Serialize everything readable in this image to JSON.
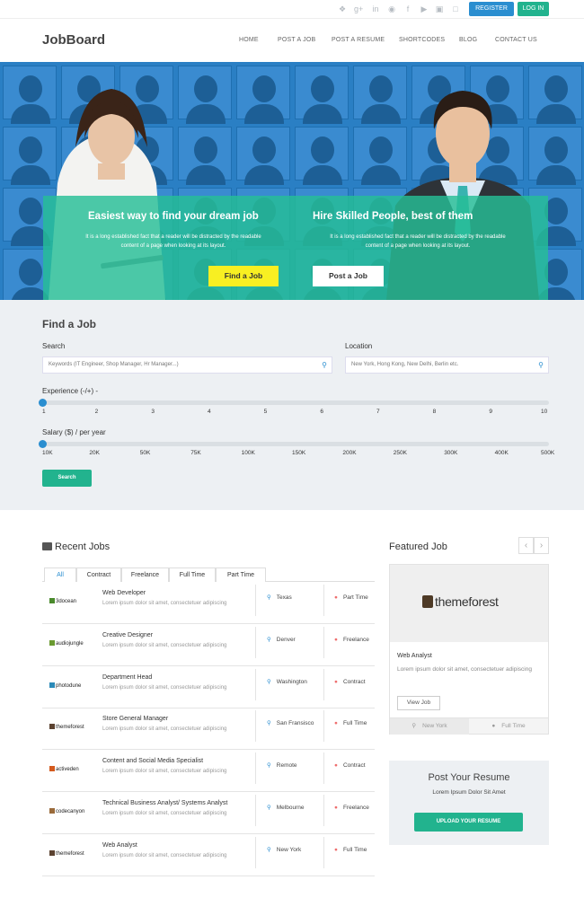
{
  "topbar": {
    "social_icons": [
      "twitter-icon",
      "google-plus-icon",
      "linkedin-icon",
      "pinterest-icon",
      "facebook-icon",
      "youtube-icon",
      "vimeo-icon",
      "vine-icon"
    ],
    "register_label": "REGISTER",
    "login_label": "LOG IN"
  },
  "header": {
    "logo": "JobBoard",
    "nav": [
      "HOME",
      "POST A JOB",
      "POST A RESUME",
      "SHORTCODES",
      "BLOG",
      "CONTACT US"
    ]
  },
  "hero": {
    "left": {
      "heading": "Easiest way to find your dream job",
      "text_line1": "It is a long established fact that a reader will be distracted by the readable",
      "text_line2": "content of a page when looking at its layout.",
      "button": "Find a Job"
    },
    "right": {
      "heading": "Hire Skilled People, best of them",
      "text_line1": "It is a long established fact that a reader will be distracted by the readable",
      "text_line2": "content of a page when looking at its layout.",
      "button": "Post a Job"
    }
  },
  "find": {
    "title": "Find a Job",
    "search_label": "Search",
    "search_placeholder": "Keywords (IT Engineer, Shop Manager, Hr Manager...)",
    "location_label": "Location",
    "location_placeholder": "New York, Hong Kong, New Delhi, Berlin etc.",
    "experience_label": "Experience (-/+) -",
    "experience_ticks": [
      "1",
      "2",
      "3",
      "4",
      "5",
      "6",
      "7",
      "8",
      "9",
      "10"
    ],
    "experience_value": 1,
    "salary_label": "Salary ($) / per year",
    "salary_ticks": [
      "10K",
      "20K",
      "50K",
      "75K",
      "100K",
      "150K",
      "200K",
      "250K",
      "300K",
      "400K",
      "500K"
    ],
    "salary_value": "10K",
    "search_button": "Search"
  },
  "recent": {
    "title": "Recent Jobs",
    "tabs": [
      "All",
      "Contract",
      "Freelance",
      "Full Time",
      "Part Time"
    ],
    "active_tab": "All",
    "jobs": [
      {
        "logo": "3docean",
        "logo_color": "#4a8a2c",
        "title": "Web Developer",
        "desc": "Lorem ipsum dolor sit amet, consectetuer adipiscing",
        "location": "Texas",
        "type": "Part Time"
      },
      {
        "logo": "audiojungle",
        "logo_color": "#6a9a30",
        "title": "Creative Designer",
        "desc": "Lorem ipsum dolor sit amet, consectetuer adipiscing",
        "location": "Denver",
        "type": "Freelance"
      },
      {
        "logo": "photodune",
        "logo_color": "#2c8ab8",
        "title": "Department Head",
        "desc": "Lorem ipsum dolor sit amet, consectetuer adipiscing",
        "location": "Washington",
        "type": "Contract"
      },
      {
        "logo": "themeforest",
        "logo_color": "#5b4230",
        "title": "Store General Manager",
        "desc": "Lorem ipsum dolor sit amet, consectetuer adipiscing",
        "location": "San Fransisco",
        "type": "Full Time"
      },
      {
        "logo": "activeden",
        "logo_color": "#d45a1e",
        "title": "Content and Social Media Specialist",
        "desc": "Lorem ipsum dolor sit amet, consectetuer adipiscing",
        "location": "Remote",
        "type": "Contract"
      },
      {
        "logo": "codecanyon",
        "logo_color": "#9a6a3a",
        "title": "Technical Business Analyst/ Systems Analyst",
        "desc": "Lorem ipsum dolor sit amet, consectetuer adipiscing",
        "location": "Melbourne",
        "type": "Freelance"
      },
      {
        "logo": "themeforest",
        "logo_color": "#5b4230",
        "title": "Web Analyst",
        "desc": "Lorem ipsum dolor sit amet, consectetuer adipiscing",
        "location": "New York",
        "type": "Full Time"
      }
    ]
  },
  "featured": {
    "title": "Featured Job",
    "logo_text": "themeforest",
    "job_title": "Web Analyst",
    "desc": "Lorem ipsum dolor sit amet, consectetuer adipiscing",
    "view_button": "View Job",
    "location": "New York",
    "type": "Full Time"
  },
  "resume": {
    "title": "Post Your Resume",
    "subtitle": "Lorem Ipsum Dolor Sit Amet",
    "button": "UPLOAD YOUR RESUME"
  },
  "colors": {
    "primary_blue": "#2a8ed0",
    "primary_green": "#22b38e",
    "find_yellow": "#f8ef22",
    "hero_blue": "#2a7fc4"
  }
}
